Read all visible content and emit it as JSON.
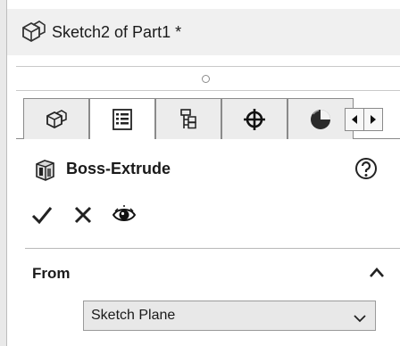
{
  "window": {
    "title": "Sketch2 of Part1 *",
    "title_icon": "part-icon"
  },
  "tabs": [
    {
      "name": "feature-manager",
      "icon": "part-icon",
      "active": false
    },
    {
      "name": "property-manager",
      "icon": "property-list-icon",
      "active": true
    },
    {
      "name": "configuration-manager",
      "icon": "configuration-tree-icon",
      "active": false
    },
    {
      "name": "dimxpert-manager",
      "icon": "crosshair-icon",
      "active": false
    },
    {
      "name": "display-manager",
      "icon": "appearance-sphere-icon",
      "active": false
    }
  ],
  "tab_scroll": {
    "left_icon": "scroll-left-icon",
    "right_icon": "scroll-right-icon"
  },
  "feature": {
    "title": "Boss-Extrude",
    "icon": "boss-extrude-icon",
    "help_icon": "help-icon"
  },
  "actions": [
    {
      "name": "ok",
      "icon": "check-icon"
    },
    {
      "name": "cancel",
      "icon": "close-icon"
    },
    {
      "name": "preview",
      "icon": "eye-icon"
    }
  ],
  "from_section": {
    "title": "From",
    "collapse_icon": "chevron-up-icon",
    "selected": "Sketch Plane"
  }
}
